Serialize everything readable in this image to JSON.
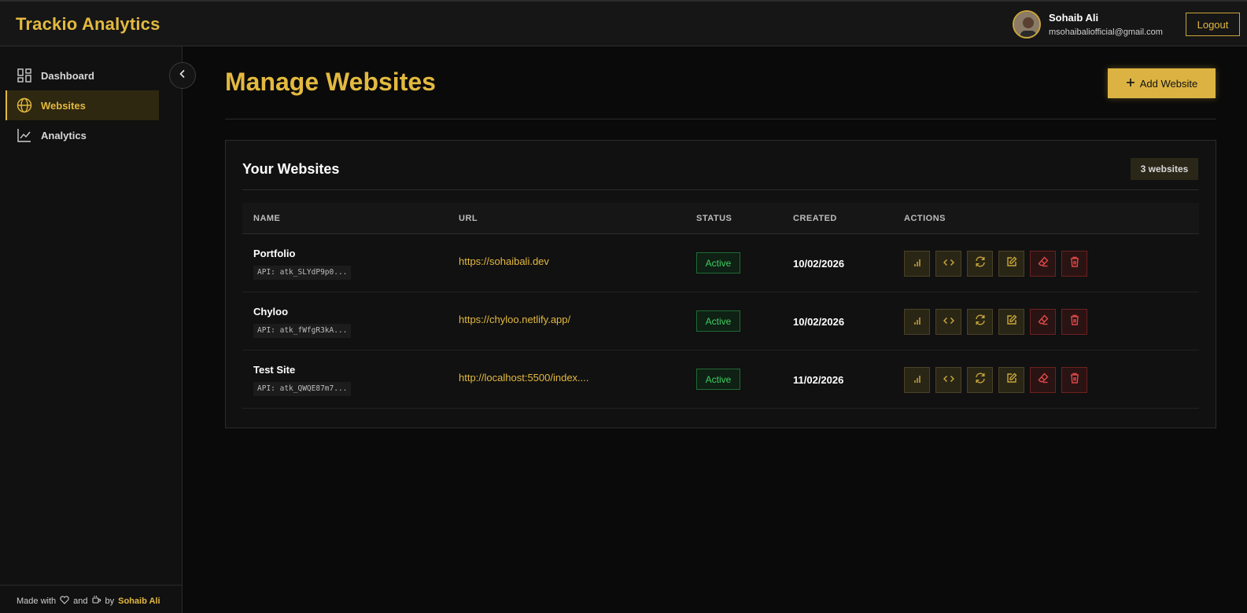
{
  "app": {
    "title": "Trackio Analytics"
  },
  "user": {
    "name": "Sohaib Ali",
    "email": "msohaibaliofficial@gmail.com",
    "logout_label": "Logout"
  },
  "sidebar": {
    "items": [
      {
        "label": "Dashboard",
        "icon": "dashboard-icon",
        "active": false
      },
      {
        "label": "Websites",
        "icon": "globe-icon",
        "active": true
      },
      {
        "label": "Analytics",
        "icon": "line-chart-icon",
        "active": false
      }
    ],
    "footer": {
      "made_with": "Made with",
      "and": "and",
      "by": "by",
      "author": "Sohaib Ali"
    }
  },
  "page": {
    "title": "Manage Websites",
    "add_button_label": "Add Website"
  },
  "websites_card": {
    "title": "Your Websites",
    "count_label": "3 websites",
    "columns": [
      "NAME",
      "URL",
      "STATUS",
      "CREATED",
      "ACTIONS"
    ],
    "rows": [
      {
        "name": "Portfolio",
        "api": "API: atk_SLYdP9p0...",
        "url": "https://sohaibali.dev",
        "status": "Active",
        "created": "10/02/2026"
      },
      {
        "name": "Chyloo",
        "api": "API: atk_fWfgR3kA...",
        "url": "https://chyloo.netlify.app/",
        "status": "Active",
        "created": "10/02/2026"
      },
      {
        "name": "Test Site",
        "api": "API: atk_QWQE87m7...",
        "url": "http://localhost:5500/index....",
        "status": "Active",
        "created": "11/02/2026"
      }
    ],
    "actions": [
      "bar-chart-icon",
      "code-icon",
      "refresh-icon",
      "edit-icon",
      "eraser-icon",
      "trash-icon"
    ]
  },
  "colors": {
    "accent": "#e3b93f",
    "background": "#0a0a0a",
    "success": "#3fcf62",
    "danger": "#e04848"
  }
}
